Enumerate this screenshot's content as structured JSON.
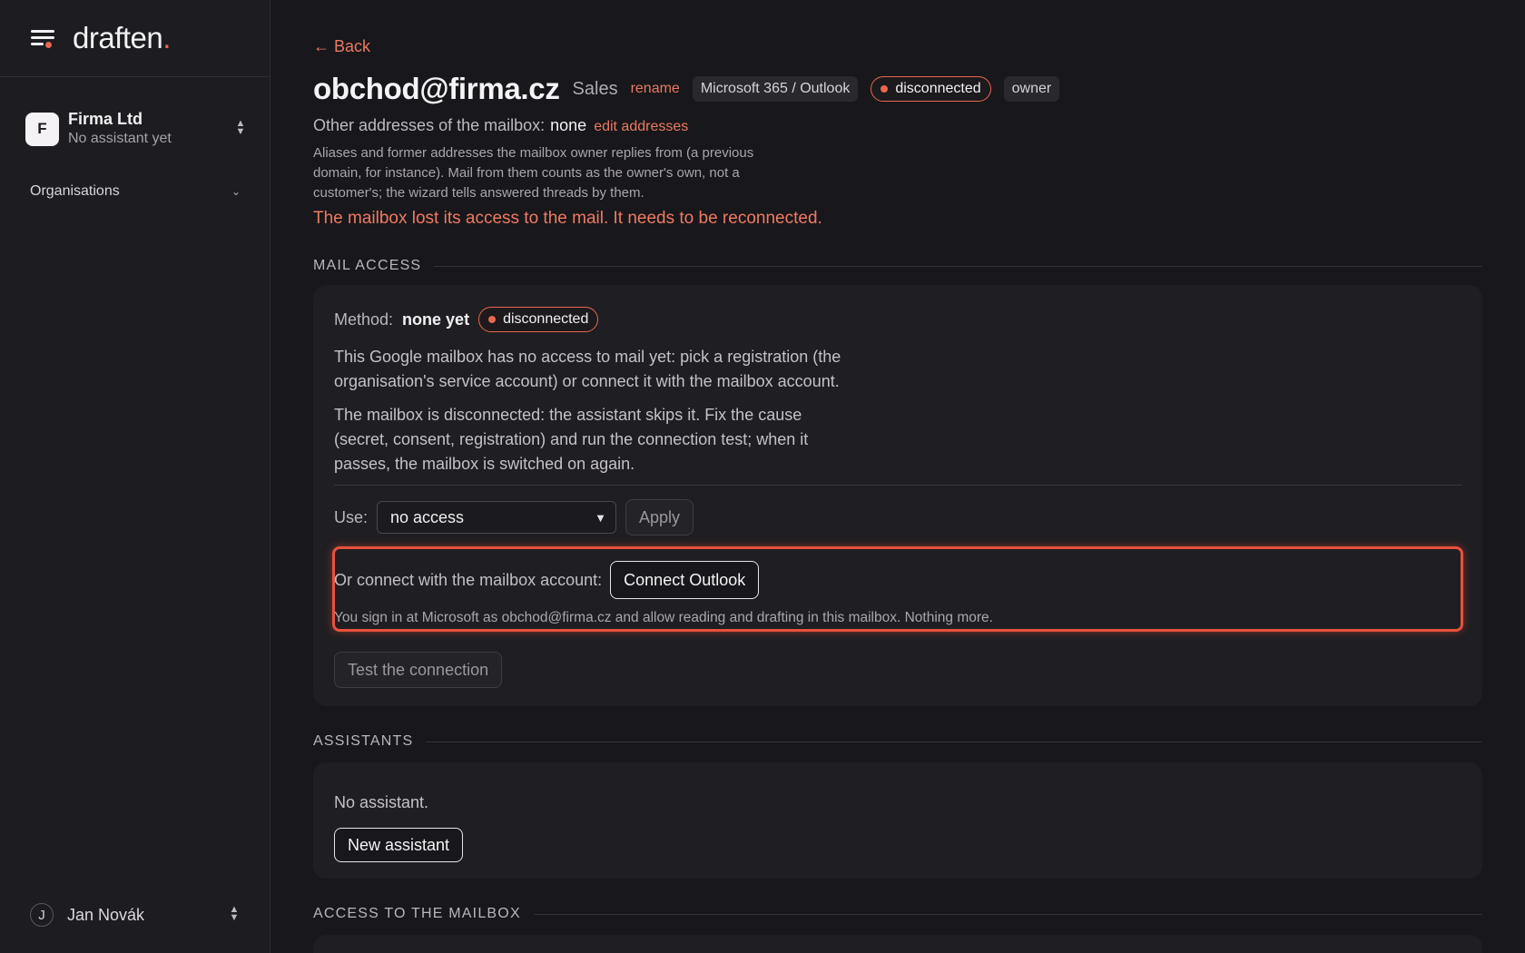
{
  "brand": {
    "name": "draften",
    "dot": "."
  },
  "sidebar": {
    "org": {
      "initial": "F",
      "name": "Firma Ltd",
      "subtitle": "No assistant yet"
    },
    "nav": [
      {
        "label": "Organisations"
      }
    ],
    "user": {
      "initial": "J",
      "name": "Jan Novák"
    }
  },
  "header": {
    "back_label": "← Back",
    "mailbox_address": "obchod@firma.cz",
    "mailbox_label": "Sales",
    "rename_label": "rename",
    "provider": "Microsoft 365 / Outlook",
    "status": "disconnected",
    "role": "owner"
  },
  "other_addresses": {
    "label": "Other addresses of the mailbox:",
    "value": "none",
    "edit_label": "edit addresses",
    "help": "Aliases and former addresses the mailbox owner replies from (a previous domain, for instance). Mail from them counts as the owner's own, not a customer's; the wizard tells answered threads by them."
  },
  "error_message": "The mailbox lost its access to the mail. It needs to be reconnected.",
  "mail_access": {
    "section_title": "MAIL ACCESS",
    "method_label": "Method:",
    "method_value": "none yet",
    "status": "disconnected",
    "info_1": "This Google mailbox has no access to mail yet: pick a registration (the organisation's service account) or connect it with the mailbox account.",
    "info_2": "The mailbox is disconnected: the assistant skips it. Fix the cause (secret, consent, registration) and run the connection test; when it passes, the mailbox is switched on again.",
    "use_label": "Use:",
    "use_selected": "no access",
    "apply_label": "Apply",
    "connect_label": "Or connect with the mailbox account:",
    "connect_button": "Connect Outlook",
    "connect_help": "You sign in at Microsoft as obchod@firma.cz and allow reading and drafting in this mailbox. Nothing more.",
    "test_button": "Test the connection"
  },
  "assistants": {
    "section_title": "ASSISTANTS",
    "empty_text": "No assistant.",
    "new_button": "New assistant"
  },
  "access": {
    "section_title": "ACCESS TO THE MAILBOX"
  },
  "colors": {
    "accent": "#e8674f",
    "background": "#18171b",
    "card": "#1f1e22",
    "highlight": "#e8513c"
  },
  "icons": [
    "menu-icon",
    "up-down-chevron-icon",
    "chevron-down-icon",
    "status-dot-icon",
    "select-caret-icon"
  ]
}
